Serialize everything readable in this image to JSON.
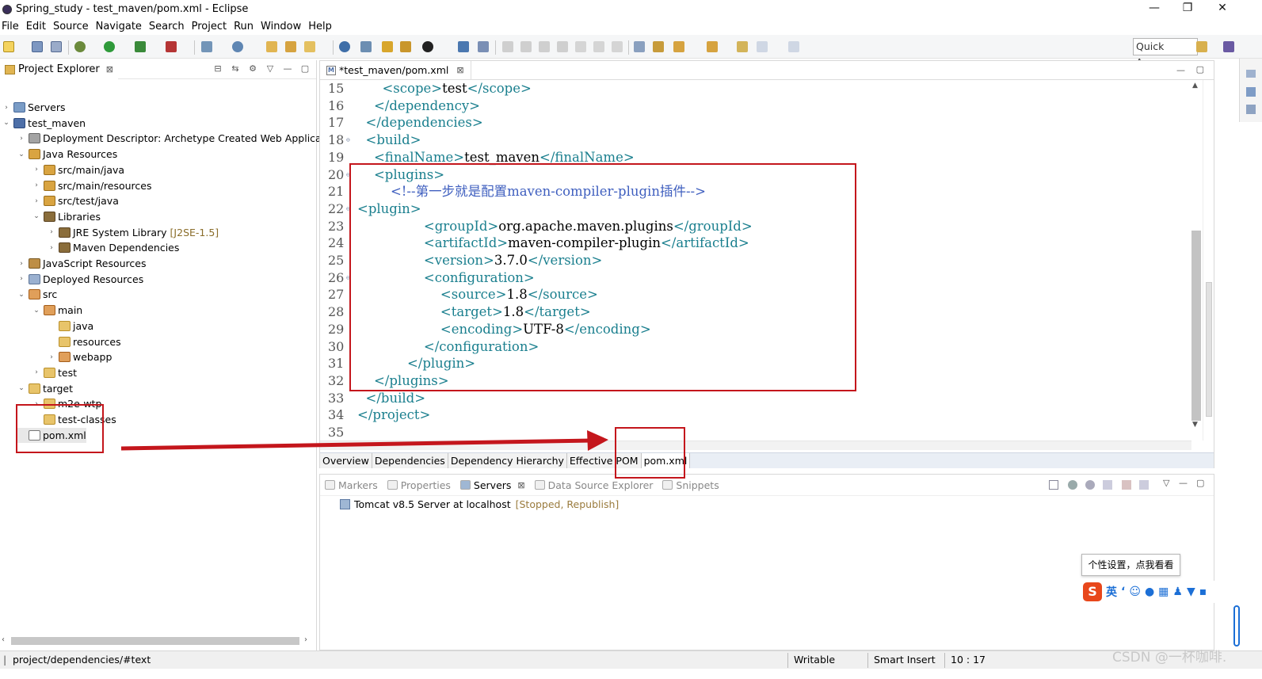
{
  "window": {
    "title": "Spring_study - test_maven/pom.xml - Eclipse",
    "minimize": "—",
    "maximize": "❐",
    "close": "✕"
  },
  "menu": [
    "File",
    "Edit",
    "Source",
    "Navigate",
    "Search",
    "Project",
    "Run",
    "Window",
    "Help"
  ],
  "toolbar": {
    "quick_access": "Quick Access"
  },
  "project_explorer": {
    "title": "Project Explorer",
    "items": [
      {
        "label": "Servers",
        "extra": "",
        "arrow": "›",
        "icon": "server-folder-icon"
      },
      {
        "label": "test_maven",
        "extra": "",
        "arrow": "⌄",
        "icon": "maven-project-icon"
      },
      {
        "label": "Deployment Descriptor: Archetype Created Web Applicatio",
        "extra": "",
        "arrow": "›",
        "icon": "deployment-descriptor-icon"
      },
      {
        "label": "Java Resources",
        "extra": "",
        "arrow": "⌄",
        "icon": "java-resources-icon"
      },
      {
        "label": "src/main/java",
        "extra": "",
        "arrow": "›",
        "icon": "source-folder-icon"
      },
      {
        "label": "src/main/resources",
        "extra": "",
        "arrow": "›",
        "icon": "source-folder-icon"
      },
      {
        "label": "src/test/java",
        "extra": "",
        "arrow": "›",
        "icon": "source-folder-icon"
      },
      {
        "label": "Libraries",
        "extra": "",
        "arrow": "⌄",
        "icon": "libraries-icon"
      },
      {
        "label": "JRE System Library",
        "extra": "[J2SE-1.5]",
        "arrow": "›",
        "icon": "library-icon"
      },
      {
        "label": "Maven Dependencies",
        "extra": "",
        "arrow": "›",
        "icon": "library-icon"
      },
      {
        "label": "JavaScript Resources",
        "extra": "",
        "arrow": "›",
        "icon": "javascript-resources-icon"
      },
      {
        "label": "Deployed Resources",
        "extra": "",
        "arrow": "›",
        "icon": "deployed-resources-icon"
      },
      {
        "label": "src",
        "extra": "",
        "arrow": "⌄",
        "icon": "src-folder-icon"
      },
      {
        "label": "main",
        "extra": "",
        "arrow": "⌄",
        "icon": "src-folder-icon"
      },
      {
        "label": "java",
        "extra": "",
        "arrow": "",
        "icon": "folder-icon"
      },
      {
        "label": "resources",
        "extra": "",
        "arrow": "",
        "icon": "folder-icon"
      },
      {
        "label": "webapp",
        "extra": "",
        "arrow": "›",
        "icon": "src-folder-icon"
      },
      {
        "label": "test",
        "extra": "",
        "arrow": "›",
        "icon": "folder-icon"
      },
      {
        "label": "target",
        "extra": "",
        "arrow": "⌄",
        "icon": "folder-icon"
      },
      {
        "label": "m2e-wtp",
        "extra": "",
        "arrow": "›",
        "icon": "folder-icon"
      },
      {
        "label": "test-classes",
        "extra": "",
        "arrow": "",
        "icon": "folder-icon"
      },
      {
        "label": "pom.xml",
        "extra": "",
        "arrow": "",
        "icon": "xml-file-icon"
      }
    ]
  },
  "editor": {
    "tab_label": "*test_maven/pom.xml",
    "lines": [
      {
        "n": "15",
        "fold": "",
        "indent": "      ",
        "parts": [
          [
            "tg",
            "<scope>"
          ],
          [
            "tx",
            "test"
          ],
          [
            "tg",
            "</scope>"
          ]
        ]
      },
      {
        "n": "16",
        "fold": "",
        "indent": "    ",
        "parts": [
          [
            "tg",
            "</dependency>"
          ]
        ]
      },
      {
        "n": "17",
        "fold": "",
        "indent": "  ",
        "parts": [
          [
            "tg",
            "</dependencies>"
          ]
        ]
      },
      {
        "n": "18",
        "fold": "⊖",
        "indent": "  ",
        "parts": [
          [
            "tg",
            "<build>"
          ]
        ]
      },
      {
        "n": "19",
        "fold": "",
        "indent": "    ",
        "parts": [
          [
            "tg",
            "<finalName>"
          ],
          [
            "tx",
            "test_maven"
          ],
          [
            "tg",
            "</finalName>"
          ]
        ]
      },
      {
        "n": "20",
        "fold": "⊖",
        "indent": "    ",
        "parts": [
          [
            "tg",
            "<plugins>"
          ]
        ]
      },
      {
        "n": "21",
        "fold": "",
        "indent": "        ",
        "parts": [
          [
            "cm",
            "<!--第一步就是配置maven-compiler-plugin插件-->"
          ]
        ]
      },
      {
        "n": "22",
        "fold": "⊖",
        "indent": "",
        "parts": [
          [
            "tg",
            "<plugin>"
          ]
        ]
      },
      {
        "n": "23",
        "fold": "",
        "indent": "                ",
        "parts": [
          [
            "tg",
            "<groupId>"
          ],
          [
            "tx",
            "org.apache.maven.plugins"
          ],
          [
            "tg",
            "</groupId>"
          ]
        ]
      },
      {
        "n": "24",
        "fold": "",
        "indent": "                ",
        "parts": [
          [
            "tg",
            "<artifactId>"
          ],
          [
            "tx",
            "maven-compiler-plugin"
          ],
          [
            "tg",
            "</artifactId>"
          ]
        ]
      },
      {
        "n": "25",
        "fold": "",
        "indent": "                ",
        "parts": [
          [
            "tg",
            "<version>"
          ],
          [
            "tx",
            "3.7.0"
          ],
          [
            "tg",
            "</version>"
          ]
        ]
      },
      {
        "n": "26",
        "fold": "⊖",
        "indent": "                ",
        "parts": [
          [
            "tg",
            "<configuration>"
          ]
        ]
      },
      {
        "n": "27",
        "fold": "",
        "indent": "                    ",
        "parts": [
          [
            "tg",
            "<source>"
          ],
          [
            "tx",
            "1.8"
          ],
          [
            "tg",
            "</source>"
          ]
        ]
      },
      {
        "n": "28",
        "fold": "",
        "indent": "                    ",
        "parts": [
          [
            "tg",
            "<target>"
          ],
          [
            "tx",
            "1.8"
          ],
          [
            "tg",
            "</target>"
          ]
        ]
      },
      {
        "n": "29",
        "fold": "",
        "indent": "                    ",
        "parts": [
          [
            "tg",
            "<encoding>"
          ],
          [
            "tx",
            "UTF-8"
          ],
          [
            "tg",
            "</encoding>"
          ]
        ]
      },
      {
        "n": "30",
        "fold": "",
        "indent": "                ",
        "parts": [
          [
            "tg",
            "</configuration>"
          ]
        ]
      },
      {
        "n": "31",
        "fold": "",
        "indent": "            ",
        "parts": [
          [
            "tg",
            "</plugin>"
          ]
        ]
      },
      {
        "n": "32",
        "fold": "",
        "indent": "    ",
        "parts": [
          [
            "tg",
            "</plugins>"
          ]
        ]
      },
      {
        "n": "33",
        "fold": "",
        "indent": "  ",
        "parts": [
          [
            "tg",
            "</build>"
          ]
        ]
      },
      {
        "n": "34",
        "fold": "",
        "indent": "",
        "parts": [
          [
            "tg",
            "</project>"
          ]
        ]
      },
      {
        "n": "35",
        "fold": "",
        "indent": "",
        "parts": []
      }
    ],
    "page_tabs": [
      "Overview",
      "Dependencies",
      "Dependency Hierarchy",
      "Effective POM",
      "pom.xml"
    ],
    "active_page_tab": "pom.xml"
  },
  "bottom_panel": {
    "tabs": [
      "Markers",
      "Properties",
      "Servers",
      "Data Source Explorer",
      "Snippets"
    ],
    "active_tab": "Servers",
    "server": {
      "name": "Tomcat v8.5 Server at localhost",
      "state": "[Stopped, Republish]"
    }
  },
  "status_bar": {
    "path": "project/dependencies/#text",
    "mode": "Writable",
    "insert": "Smart Insert",
    "position": "10 : 17"
  },
  "ime": {
    "tip": "个性设置，点我看看",
    "logo": "S",
    "lang": "英"
  },
  "watermark": "CSDN @一杯咖啡.",
  "colors": {
    "tag": "#1a7f8e",
    "comment": "#3f5fbf",
    "annotation_red": "#c4161c"
  }
}
